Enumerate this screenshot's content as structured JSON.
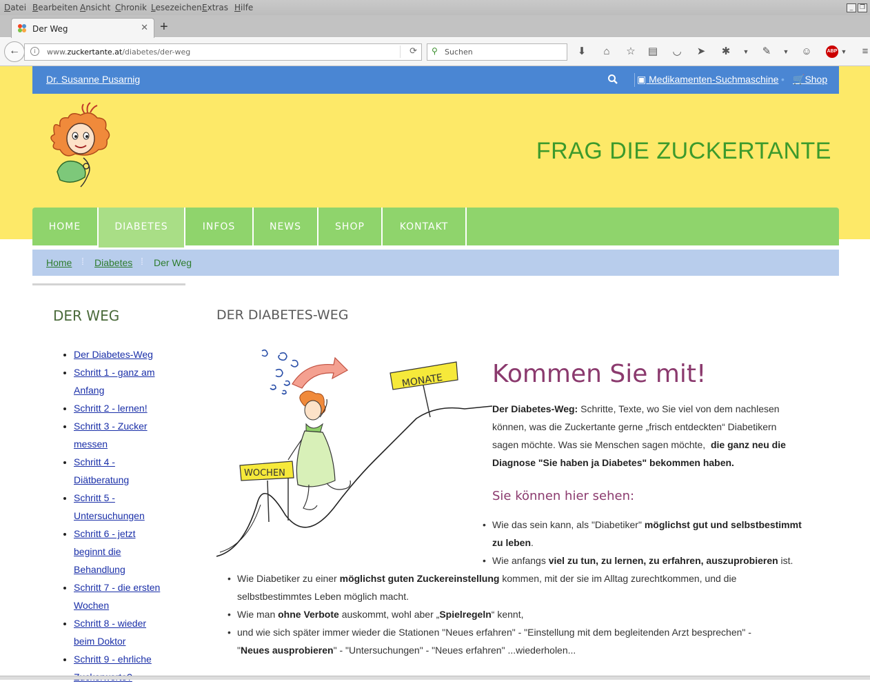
{
  "browser": {
    "menu": [
      "Datei",
      "Bearbeiten",
      "Ansicht",
      "Chronik",
      "Lesezeichen",
      "Extras",
      "Hilfe"
    ],
    "tab_title": "Der Weg",
    "url_prefix": "www.",
    "url_domain": "zuckertante.at",
    "url_path": "/diabetes/der-weg",
    "search_placeholder": "Suchen",
    "abp": "ABP"
  },
  "topbar": {
    "author": "Dr. Susanne Pusarnig",
    "med_search": "Medikamenten-Suchmaschine",
    "shop": "Shop"
  },
  "site_title": "FRAG DIE ZUCKERTANTE",
  "nav": [
    "HOME",
    "DIABETES",
    "INFOS",
    "NEWS",
    "SHOP",
    "KONTAKT"
  ],
  "breadcrumb": [
    "Home",
    "Diabetes",
    "Der Weg"
  ],
  "sidebar": {
    "heading": "DER WEG",
    "items": [
      [
        "Der Diabetes-Weg"
      ],
      [
        "Schritt 1 - ganz am",
        "Anfang"
      ],
      [
        "Schritt 2 - lernen!"
      ],
      [
        "Schritt 3 - Zucker",
        "messen"
      ],
      [
        "Schritt 4 -",
        "Diätberatung"
      ],
      [
        "Schritt 5 -",
        "Untersuchungen"
      ],
      [
        "Schritt 6 - jetzt",
        "beginnt die",
        "Behandlung"
      ],
      [
        "Schritt 7 - die ersten",
        "Wochen"
      ],
      [
        "Schritt 8 - wieder",
        "beim Doktor"
      ],
      [
        "Schritt 9 - ehrliche",
        "Zuckerwerte?"
      ]
    ]
  },
  "main": {
    "heading": "DER DIABETES-WEG",
    "illus_labels": {
      "top": "MONATE",
      "bottom": "WOCHEN"
    },
    "kommen": "Kommen Sie mit!",
    "intro_bold": "Der Diabetes-Weg:",
    "intro_text1": " Schritte, Texte, wo Sie viel von dem nachlesen",
    "intro_text2": "können, was die Zuckertante gerne „frisch entdeckten“ Diabetikern",
    "intro_text3": "sagen möchte. Was sie Menschen sagen möchte,",
    "intro_bold2a": "die ganz neu die",
    "intro_bold2b": "Diagnose \"Sie haben ja Diabetes\" bekommen haben.",
    "subhead": "Sie können hier sehen:",
    "b1_a": "Wie das sein kann, als \"Diabetiker\" ",
    "b1_b": "möglichst gut und selbstbestimmt",
    "b1_c": "zu leben",
    "b1_d": ".",
    "b2_a": "Wie anfangs ",
    "b2_b": "viel zu tun, zu lernen, zu erfahren, auszuprobieren",
    "b2_c": " ist.",
    "b3_a": "Wie Diabetiker zu einer ",
    "b3_b": "möglichst guten Zuckereinstellung",
    "b3_c": " kommen, mit der sie im Alltag zurechtkommen, und die",
    "b3_d": "selbstbestimmtes Leben möglich macht.",
    "b4_a": "Wie man ",
    "b4_b": "ohne Verbote",
    "b4_c": " auskommt, wohl aber „",
    "b4_d": "Spielregeln",
    "b4_e": "“ kennt,",
    "b5_a": "und wie sich später immer wieder die Stationen \"Neues erfahren\" - \"Einstellung mit dem begleitenden Arzt besprechen\" -",
    "b5_b": "\"",
    "b5_c": "Neues ausprobieren",
    "b5_d": "\" - \"Untersuchungen\" - \"Neues erfahren\" ...wiederholen..."
  },
  "colors": {
    "topbar": "#4a86d3",
    "yellow": "#fde968",
    "nav_green": "#8fd46c",
    "title_green": "#3c9a2c",
    "accent_purple": "#8b3a6e"
  }
}
